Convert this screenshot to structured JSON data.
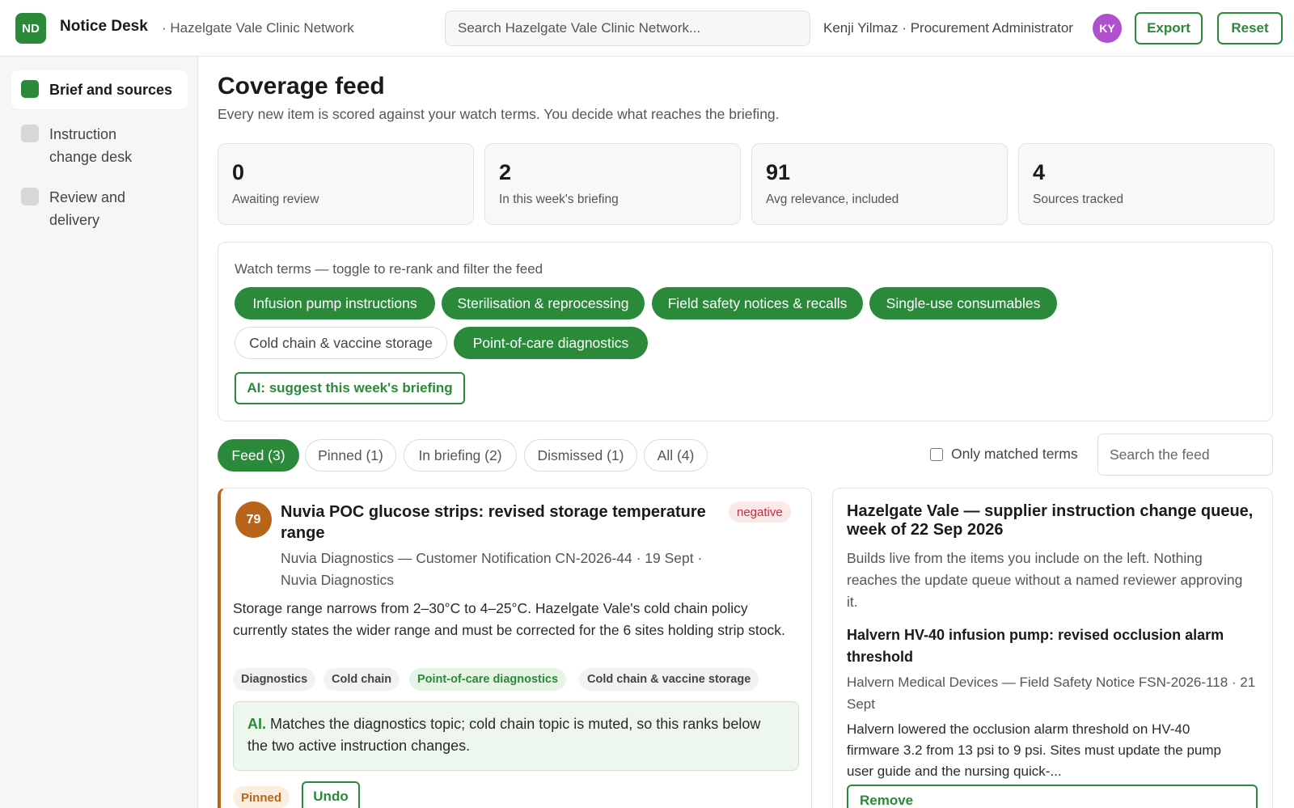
{
  "app": {
    "logo_text": "ND",
    "name": "Notice Desk",
    "org": "· Hazelgate Vale Clinic Network",
    "brand_color": "#2b8a3a"
  },
  "header": {
    "search_placeholder": "Search Hazelgate Vale Clinic Network...",
    "user_label": "Kenji Yilmaz · Procurement Administrator",
    "avatar_initials": "KY",
    "export_label": "Export",
    "reset_label": "Reset"
  },
  "sidebar": {
    "items": [
      {
        "label": "Brief and sources",
        "active": true
      },
      {
        "label": "Instruction change desk",
        "active": false
      },
      {
        "label": "Review and delivery",
        "active": false
      }
    ]
  },
  "main": {
    "title": "Coverage feed",
    "subtitle": "Every new item is scored against your watch terms. You decide what reaches the briefing.",
    "stats": [
      {
        "value": "0",
        "label": "Awaiting review"
      },
      {
        "value": "2",
        "label": "In this week's briefing"
      },
      {
        "value": "91",
        "label": "Avg relevance, included"
      },
      {
        "value": "4",
        "label": "Sources tracked"
      }
    ],
    "watch": {
      "title": "Watch terms — toggle to re-rank and filter the feed",
      "terms": [
        {
          "label": "Infusion pump instructions",
          "on": true
        },
        {
          "label": "Sterilisation & reprocessing",
          "on": true
        },
        {
          "label": "Field safety notices & recalls",
          "on": true
        },
        {
          "label": "Single-use consumables",
          "on": true
        },
        {
          "label": "Cold chain & vaccine storage",
          "on": false
        },
        {
          "label": "Point-of-care diagnostics",
          "on": true
        }
      ],
      "ai_button": "AI: suggest this week's briefing"
    },
    "tabs": [
      {
        "label": "Feed (3)",
        "active": true
      },
      {
        "label": "Pinned (1)",
        "active": false
      },
      {
        "label": "In briefing (2)",
        "active": false
      },
      {
        "label": "Dismissed (1)",
        "active": false
      },
      {
        "label": "All (4)",
        "active": false
      }
    ],
    "only_matched_label": "Only matched terms",
    "feed_search_placeholder": "Search the feed"
  },
  "feed_item": {
    "score": "79",
    "title": "Nuvia POC glucose strips: revised storage temperature range",
    "sentiment": "negative",
    "meta": "Nuvia Diagnostics — Customer Notification CN-2026-44 · 19 Sept · Nuvia Diagnostics",
    "body": "Storage range narrows from 2–30°C to 4–25°C. Hazelgate Vale's cold chain policy currently states the wider range and must be corrected for the 6 sites holding strip stock.",
    "tags": [
      {
        "label": "Diagnostics",
        "matched": false
      },
      {
        "label": "Cold chain",
        "matched": false
      },
      {
        "label": "Point-of-care diagnostics",
        "matched": true
      },
      {
        "label": "Cold chain & vaccine storage",
        "matched": false
      }
    ],
    "ai_label": "AI.",
    "ai_text": "Matches the diagnostics topic; cold chain topic is muted, so this ranks below the two active instruction changes.",
    "pinned_label": "Pinned",
    "undo_label": "Undo",
    "accent_color": "#b8651a"
  },
  "briefing": {
    "title": "Hazelgate Vale — supplier instruction change queue, week of 22 Sep 2026",
    "description": "Builds live from the items you include on the left. Nothing reaches the update queue without a named reviewer approving it.",
    "item": {
      "title": "Halvern HV-40 infusion pump: revised occlusion alarm threshold",
      "meta": "Halvern Medical Devices — Field Safety Notice FSN-2026-118 · 21 Sept",
      "body": "Halvern lowered the occlusion alarm threshold on HV-40 firmware 3.2 from 13 psi to 9 psi. Sites must update the pump user guide and the nursing quick-...",
      "remove_label": "Remove"
    }
  }
}
